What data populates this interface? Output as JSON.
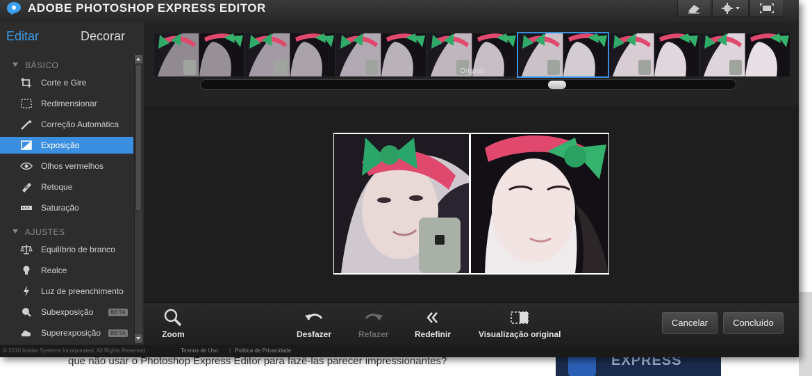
{
  "app": {
    "title": "ADOBE PHOTOSHOP EXPRESS EDITOR"
  },
  "titlebar_buttons": [
    {
      "icon": "eraser-icon"
    },
    {
      "icon": "gear-icon"
    },
    {
      "icon": "fullscreen-icon"
    }
  ],
  "sidebar": {
    "tabs": [
      "Editar",
      "Decorar"
    ],
    "sections": [
      {
        "title": "BÁSICO",
        "items": [
          {
            "label": "Corte e Gire",
            "icon": "crop-icon"
          },
          {
            "label": "Redimensionar",
            "icon": "resize-icon"
          },
          {
            "label": "Correção Automática",
            "icon": "magic-wand-icon"
          },
          {
            "label": "Exposição",
            "icon": "exposure-icon",
            "active": true
          },
          {
            "label": "Olhos vermelhos",
            "icon": "eye-icon"
          },
          {
            "label": "Retoque",
            "icon": "bandage-icon"
          },
          {
            "label": "Saturação",
            "icon": "saturation-icon"
          }
        ]
      },
      {
        "title": "AJUSTES",
        "items": [
          {
            "label": "Equilíbrio de branco",
            "icon": "scale-icon"
          },
          {
            "label": "Realce",
            "icon": "bulb-icon"
          },
          {
            "label": "Luz de preenchimento",
            "icon": "lightning-icon"
          },
          {
            "label": "Subexposição",
            "icon": "magnifier-icon",
            "badge": "BETA"
          },
          {
            "label": "Superexposição",
            "icon": "cloud-icon",
            "badge": "BETA"
          }
        ]
      }
    ]
  },
  "filmstrip": {
    "original_label": "Original",
    "selected_index": 4,
    "thumb_count": 7,
    "slider_position": 0.67
  },
  "toolbar": {
    "zoom": "Zoom",
    "undo": "Desfazer",
    "redo": "Refazer",
    "reset": "Redefinir",
    "view_original": "Visualização original",
    "cancel": "Cancelar",
    "done": "Concluído"
  },
  "footer": {
    "copyright": "© 2010 Adobe Systems Incorporated. All Rights Reserved.",
    "terms": "Termos de Uso",
    "separator": "|",
    "privacy": "Política de Privacidade"
  },
  "background_page": {
    "line1": "que não usar o Photoshop Express Editor para fazê-las parecer impressionantes?",
    "ad_text": "EXPRESS"
  },
  "colors": {
    "accent": "#3b8fe0",
    "panel": "#2d2d2d",
    "titlebar": "#2e2e2e"
  }
}
